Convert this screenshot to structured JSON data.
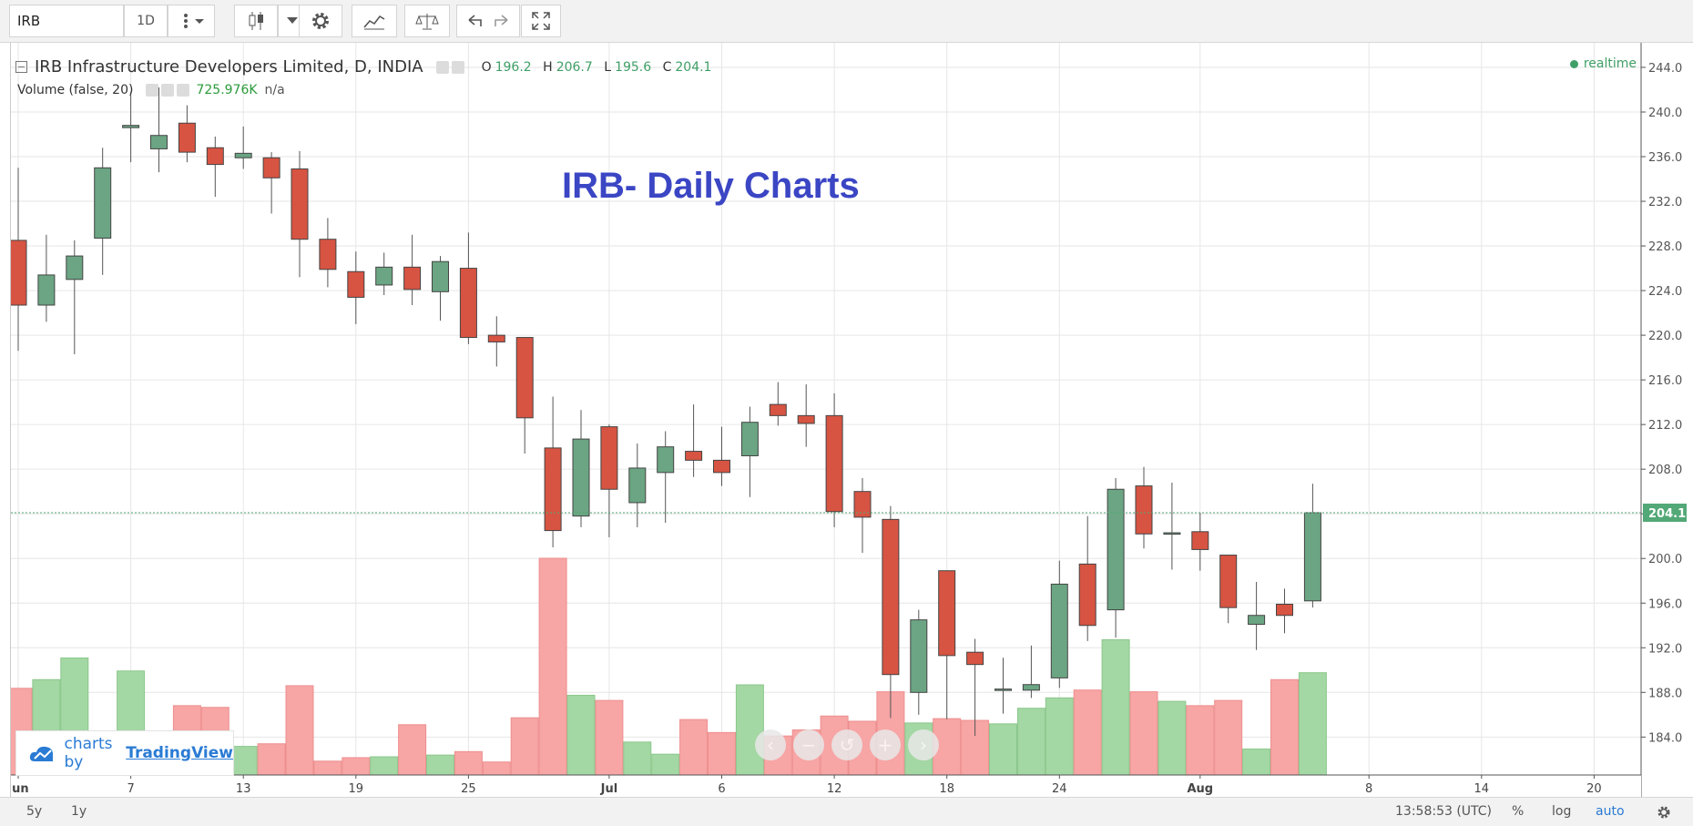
{
  "toolbar": {
    "symbol": "IRB",
    "interval": "1D"
  },
  "legend": {
    "title": "IRB Infrastructure Developers Limited, D, INDIA",
    "ohlc": {
      "o_label": "O",
      "o": "196.2",
      "h_label": "H",
      "h": "206.7",
      "l_label": "L",
      "l": "195.6",
      "c_label": "C",
      "c": "204.1"
    },
    "volume_label": "Volume (false, 20)",
    "volume_value": "725.976K",
    "volume_extra": "n/a"
  },
  "realtime": "realtime",
  "annotation": "IRB- Daily Charts",
  "watermark": "charts by",
  "watermark_brand": "TradingView",
  "bottom": {
    "range_5y": "5y",
    "range_1y": "1y",
    "time": "13:58:53 (UTC)",
    "percent": "%",
    "log": "log",
    "auto": "auto"
  },
  "colors": {
    "up": "#6ba583",
    "down": "#d75442",
    "vol_up": "#a3d7a3",
    "vol_down": "#f7a5a5",
    "grid": "#e6e6e6",
    "last_price_bg": "#52a876",
    "annotation": "#3b46c4"
  },
  "chart_data": {
    "type": "candlestick",
    "title": "IRB Infrastructure Developers Limited, D, INDIA",
    "y_ticks": [
      184,
      188,
      192,
      196,
      200,
      204,
      208,
      212,
      216,
      220,
      224,
      228,
      232,
      236,
      240,
      244
    ],
    "y_tick_labels": [
      "184.0",
      "188.0",
      "192.0",
      "196.0",
      "200.0",
      "204.0",
      "208.0",
      "212.0",
      "216.0",
      "220.0",
      "224.0",
      "228.0",
      "232.0",
      "236.0",
      "240.0",
      "244.0"
    ],
    "ylim": [
      180.6,
      246.2
    ],
    "x_tick_labels": [
      {
        "label": "Jun",
        "index": 0
      },
      {
        "label": "7",
        "index": 4
      },
      {
        "label": "13",
        "index": 8
      },
      {
        "label": "19",
        "index": 12
      },
      {
        "label": "25",
        "index": 16
      },
      {
        "label": "Jul",
        "index": 21
      },
      {
        "label": "6",
        "index": 25
      },
      {
        "label": "12",
        "index": 29
      },
      {
        "label": "18",
        "index": 33
      },
      {
        "label": "24",
        "index": 37
      },
      {
        "label": "Aug",
        "index": 42
      },
      {
        "label": "8",
        "index": 48
      },
      {
        "label": "14",
        "index": 52
      },
      {
        "label": "20",
        "index": 56
      }
    ],
    "last_price": 204.1,
    "last_price_label": "204.1",
    "candles": [
      {
        "o": 228.5,
        "h": 235.0,
        "l": 218.6,
        "c": 222.7
      },
      {
        "o": 222.7,
        "h": 229.0,
        "l": 221.2,
        "c": 225.4
      },
      {
        "o": 225.0,
        "h": 228.5,
        "l": 218.3,
        "c": 227.1
      },
      {
        "o": 228.7,
        "h": 236.8,
        "l": 225.4,
        "c": 235.0
      },
      {
        "o": 238.6,
        "h": 241.8,
        "l": 235.5,
        "c": 238.8
      },
      {
        "o": 236.7,
        "h": 242.2,
        "l": 234.6,
        "c": 237.9
      },
      {
        "o": 239.0,
        "h": 240.6,
        "l": 235.5,
        "c": 236.4
      },
      {
        "o": 236.8,
        "h": 237.8,
        "l": 232.4,
        "c": 235.3
      },
      {
        "o": 235.9,
        "h": 238.7,
        "l": 234.9,
        "c": 236.3
      },
      {
        "o": 235.9,
        "h": 236.4,
        "l": 230.9,
        "c": 234.1
      },
      {
        "o": 234.9,
        "h": 236.5,
        "l": 225.2,
        "c": 228.6
      },
      {
        "o": 228.6,
        "h": 230.5,
        "l": 224.3,
        "c": 225.9
      },
      {
        "o": 225.7,
        "h": 227.5,
        "l": 221.0,
        "c": 223.4
      },
      {
        "o": 224.5,
        "h": 227.4,
        "l": 223.6,
        "c": 226.1
      },
      {
        "o": 226.1,
        "h": 229.0,
        "l": 222.7,
        "c": 224.1
      },
      {
        "o": 223.9,
        "h": 227.1,
        "l": 221.3,
        "c": 226.6
      },
      {
        "o": 226.0,
        "h": 229.2,
        "l": 219.2,
        "c": 219.8
      },
      {
        "o": 220.0,
        "h": 221.7,
        "l": 217.2,
        "c": 219.4
      },
      {
        "o": 219.8,
        "h": 219.8,
        "l": 209.4,
        "c": 212.6
      },
      {
        "o": 209.9,
        "h": 214.5,
        "l": 201.0,
        "c": 202.5
      },
      {
        "o": 203.8,
        "h": 213.3,
        "l": 202.8,
        "c": 210.7
      },
      {
        "o": 211.8,
        "h": 212.0,
        "l": 201.9,
        "c": 206.2
      },
      {
        "o": 205.0,
        "h": 210.3,
        "l": 202.8,
        "c": 208.1
      },
      {
        "o": 207.7,
        "h": 211.4,
        "l": 203.2,
        "c": 210.0
      },
      {
        "o": 209.6,
        "h": 213.8,
        "l": 207.3,
        "c": 208.8
      },
      {
        "o": 208.8,
        "h": 211.8,
        "l": 206.5,
        "c": 207.7
      },
      {
        "o": 209.2,
        "h": 213.6,
        "l": 205.5,
        "c": 212.2
      },
      {
        "o": 213.8,
        "h": 215.8,
        "l": 211.9,
        "c": 212.8
      },
      {
        "o": 212.8,
        "h": 215.6,
        "l": 210.0,
        "c": 212.1
      },
      {
        "o": 212.8,
        "h": 214.8,
        "l": 202.8,
        "c": 204.2
      },
      {
        "o": 206.0,
        "h": 207.2,
        "l": 200.5,
        "c": 203.7
      },
      {
        "o": 203.5,
        "h": 204.7,
        "l": 185.7,
        "c": 189.6
      },
      {
        "o": 188.0,
        "h": 195.4,
        "l": 186.0,
        "c": 194.5
      },
      {
        "o": 198.9,
        "h": 198.9,
        "l": 185.6,
        "c": 191.3
      },
      {
        "o": 191.6,
        "h": 192.8,
        "l": 184.1,
        "c": 190.5
      },
      {
        "o": 188.2,
        "h": 191.1,
        "l": 186.1,
        "c": 188.3
      },
      {
        "o": 188.2,
        "h": 192.2,
        "l": 187.5,
        "c": 188.7
      },
      {
        "o": 189.3,
        "h": 199.8,
        "l": 188.4,
        "c": 197.7
      },
      {
        "o": 199.5,
        "h": 203.8,
        "l": 192.6,
        "c": 194.0
      },
      {
        "o": 195.4,
        "h": 207.2,
        "l": 192.9,
        "c": 206.2
      },
      {
        "o": 206.5,
        "h": 208.2,
        "l": 200.9,
        "c": 202.2
      },
      {
        "o": 202.3,
        "h": 206.8,
        "l": 199.0,
        "c": 202.3
      },
      {
        "o": 202.4,
        "h": 204.1,
        "l": 198.9,
        "c": 200.8
      },
      {
        "o": 200.3,
        "h": 200.3,
        "l": 194.2,
        "c": 195.6
      },
      {
        "o": 194.1,
        "h": 197.9,
        "l": 191.8,
        "c": 194.9
      },
      {
        "o": 195.9,
        "h": 197.3,
        "l": 193.3,
        "c": 194.9
      },
      {
        "o": 196.2,
        "h": 206.7,
        "l": 195.6,
        "c": 204.1
      }
    ],
    "volume": [
      {
        "v": 1.0,
        "up": false
      },
      {
        "v": 1.1,
        "up": true
      },
      {
        "v": 1.35,
        "up": true
      },
      {
        "v": 0.4,
        "up": true
      },
      {
        "v": 1.2,
        "up": true
      },
      {
        "v": 0.3,
        "up": false
      },
      {
        "v": 0.8,
        "up": false
      },
      {
        "v": 0.78,
        "up": false
      },
      {
        "v": 0.33,
        "up": true
      },
      {
        "v": 0.36,
        "up": false
      },
      {
        "v": 1.03,
        "up": false
      },
      {
        "v": 0.16,
        "up": false
      },
      {
        "v": 0.2,
        "up": false
      },
      {
        "v": 0.21,
        "up": true
      },
      {
        "v": 0.58,
        "up": false
      },
      {
        "v": 0.23,
        "up": true
      },
      {
        "v": 0.27,
        "up": false
      },
      {
        "v": 0.15,
        "up": false
      },
      {
        "v": 0.66,
        "up": false
      },
      {
        "v": 2.5,
        "up": false
      },
      {
        "v": 0.92,
        "up": true
      },
      {
        "v": 0.86,
        "up": false
      },
      {
        "v": 0.38,
        "up": true
      },
      {
        "v": 0.24,
        "up": true
      },
      {
        "v": 0.64,
        "up": false
      },
      {
        "v": 0.49,
        "up": false
      },
      {
        "v": 1.04,
        "up": true
      },
      {
        "v": 0.45,
        "up": false
      },
      {
        "v": 0.52,
        "up": false
      },
      {
        "v": 0.68,
        "up": false
      },
      {
        "v": 0.62,
        "up": false
      },
      {
        "v": 0.96,
        "up": false
      },
      {
        "v": 0.6,
        "up": true
      },
      {
        "v": 0.65,
        "up": false
      },
      {
        "v": 0.63,
        "up": false
      },
      {
        "v": 0.59,
        "up": true
      },
      {
        "v": 0.77,
        "up": true
      },
      {
        "v": 0.89,
        "up": true
      },
      {
        "v": 0.98,
        "up": false
      },
      {
        "v": 1.56,
        "up": true
      },
      {
        "v": 0.96,
        "up": false
      },
      {
        "v": 0.85,
        "up": true
      },
      {
        "v": 0.8,
        "up": false
      },
      {
        "v": 0.86,
        "up": false
      },
      {
        "v": 0.3,
        "up": true
      },
      {
        "v": 1.1,
        "up": false
      },
      {
        "v": 1.18,
        "up": true
      }
    ]
  }
}
